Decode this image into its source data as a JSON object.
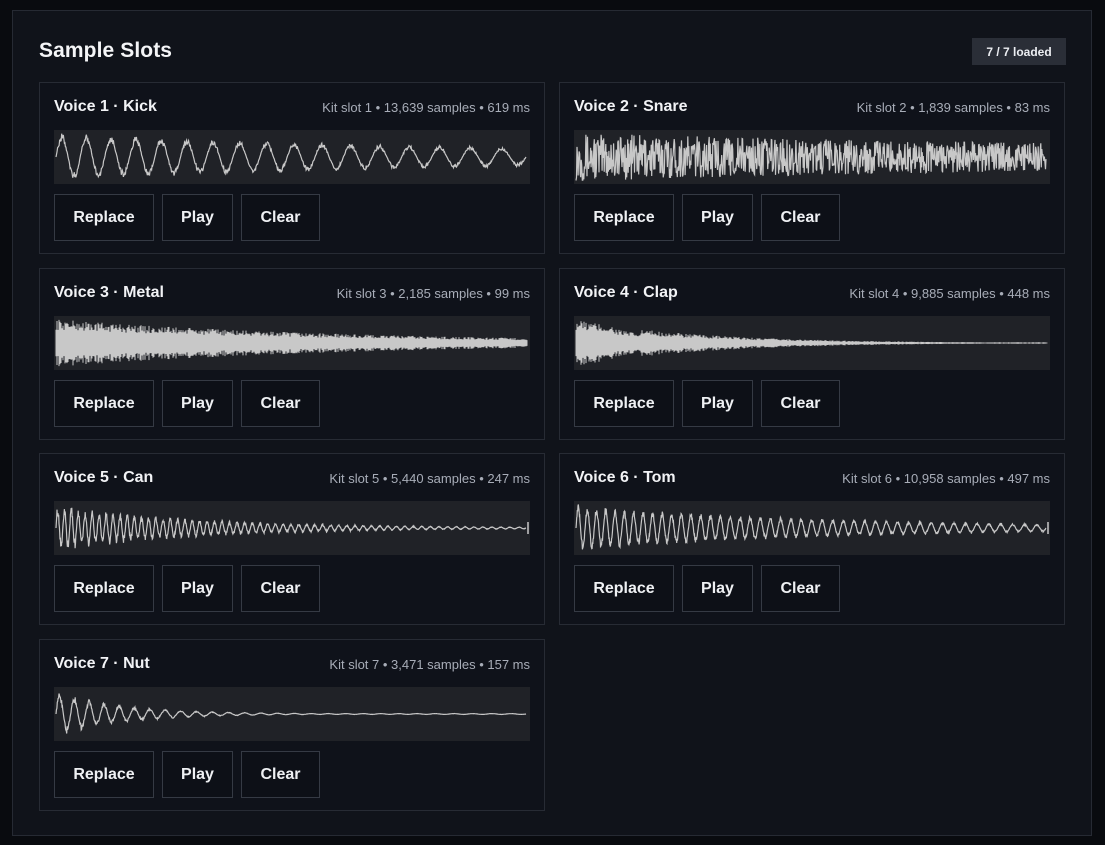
{
  "panel": {
    "title": "Sample Slots",
    "badge": "7 / 7 loaded"
  },
  "buttons": {
    "replace": "Replace",
    "play": "Play",
    "clear": "Clear"
  },
  "colors": {
    "waveform": "#c8c8c8",
    "waveform_bg": "#202227"
  },
  "slots": [
    {
      "title": "Voice 1 · Kick",
      "meta": "Kit slot 1 • 13,639 samples • 619 ms",
      "wave": "kick"
    },
    {
      "title": "Voice 2 · Snare",
      "meta": "Kit slot 2 • 1,839 samples • 83 ms",
      "wave": "snare"
    },
    {
      "title": "Voice 3 · Metal",
      "meta": "Kit slot 3 • 2,185 samples • 99 ms",
      "wave": "metal"
    },
    {
      "title": "Voice 4 · Clap",
      "meta": "Kit slot 4 • 9,885 samples • 448 ms",
      "wave": "clap"
    },
    {
      "title": "Voice 5 · Can",
      "meta": "Kit slot 5 • 5,440 samples • 247 ms",
      "wave": "can"
    },
    {
      "title": "Voice 6 · Tom",
      "meta": "Kit slot 6 • 10,958 samples • 497 ms",
      "wave": "tom"
    },
    {
      "title": "Voice 7 · Nut",
      "meta": "Kit slot 7 • 3,471 samples • 157 ms",
      "wave": "nut"
    }
  ]
}
